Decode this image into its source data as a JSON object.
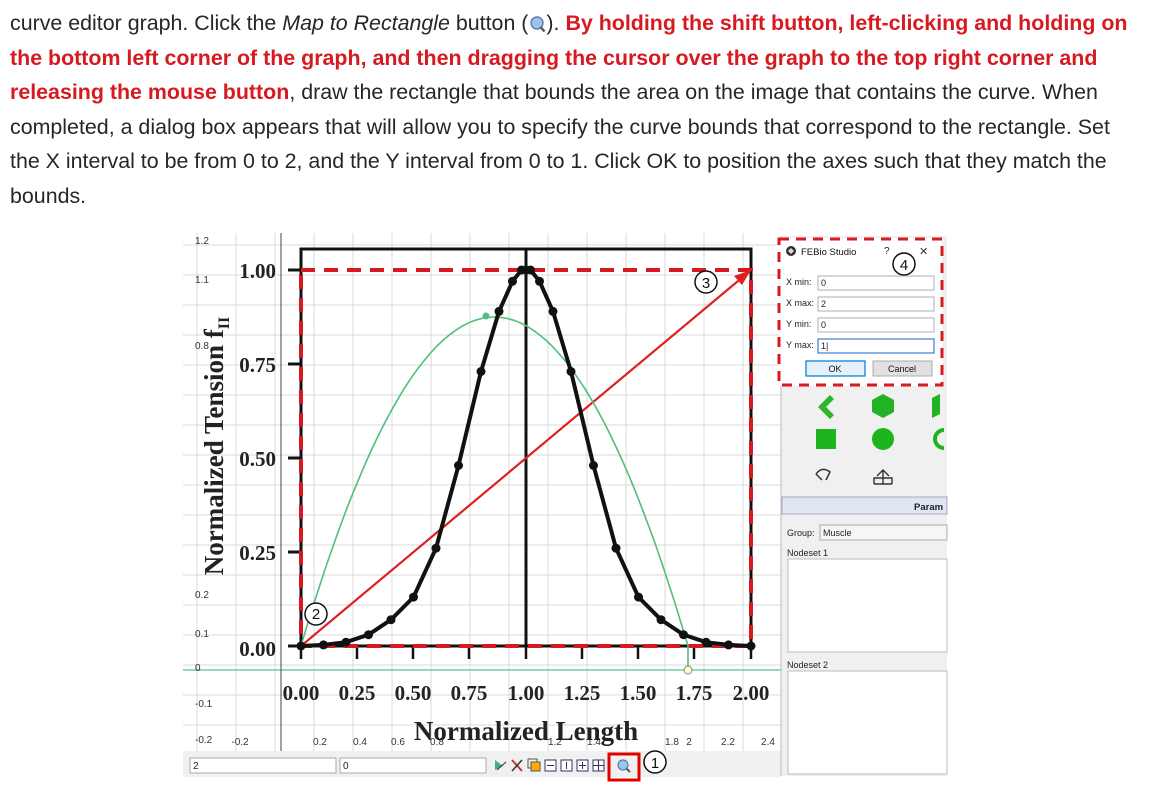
{
  "paragraph": {
    "s1": "curve editor graph. Click the ",
    "s2": "Map to Rectangle",
    "s3": " button (",
    "s4": "). ",
    "s5": "By holding the shift button, left-clicking and holding on the bottom left corner of the graph, and then dragging the cursor over the graph to the top right corner and releasing the mouse button",
    "s6": ", draw the rectangle that bounds the area on the image that contains the curve. When completed, a dialog box appears that will allow you to specify the curve bounds that correspond to the rectangle. Set the X interval to be from 0 to 2, and the Y interval from 0 to 1. Click OK to position the axes such that they match the bounds."
  },
  "graph_image": {
    "ylabel": "Normalized Tension f",
    "ylabel_sub": "II",
    "xlabel": "Normalized Length",
    "yticks": [
      "1.00",
      "0.75",
      "0.50",
      "0.25",
      "0.00"
    ],
    "xticks": [
      "0.00",
      "0.25",
      "0.50",
      "0.75",
      "1.00",
      "1.25",
      "1.50",
      "1.75",
      "2.00"
    ]
  },
  "editor_axes": {
    "left_ticks": [
      "1.2",
      "1.1",
      "0.8",
      "0.2",
      "0.1",
      "0",
      "-0.1",
      "-0.2"
    ],
    "bottom_ticks": [
      "-0.2",
      "0.2",
      "0.4",
      "0.6",
      "0.8",
      "1.2",
      "1.4",
      "1.8",
      "2",
      "2.2",
      "2.4"
    ]
  },
  "bottom_bar": {
    "field1_value": "2",
    "field2_value": "0"
  },
  "callouts": [
    "1",
    "2",
    "3",
    "4"
  ],
  "dialog": {
    "title": "FEBio Studio",
    "help": "?",
    "close": "✕",
    "fields": [
      {
        "label": "X min:",
        "value": "0"
      },
      {
        "label": "X max:",
        "value": "2"
      },
      {
        "label": "Y min:",
        "value": "0"
      },
      {
        "label": "Y max:",
        "value": "1|"
      }
    ],
    "ok": "OK",
    "cancel": "Cancel"
  },
  "side_panel": {
    "params_header": "Param",
    "group_label": "Group:",
    "group_value": "Muscle",
    "nodeset1": "Nodeset 1",
    "nodeset2": "Nodeset 2"
  },
  "colors": {
    "highlight_red": "#d71920",
    "curve_green": "#4fbf7a",
    "shape_green": "#1db41d"
  },
  "icons": [
    "magnifier-icon",
    "febio-logo-icon"
  ]
}
